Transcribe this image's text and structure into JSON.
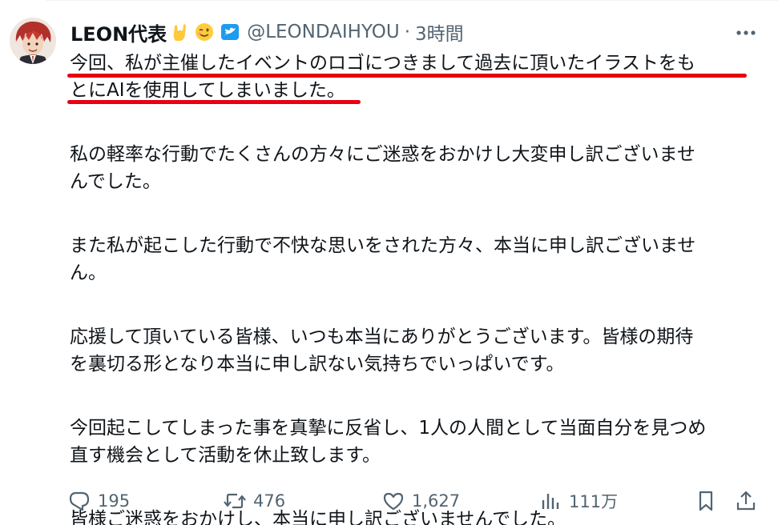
{
  "tweet": {
    "author": {
      "name": "LEON代表",
      "handle": "@LEONDAIHYOU",
      "emoji_1": "sign-of-horns-emoji",
      "emoji_2": "winking-face-emoji",
      "badge": "verified-badge-icon"
    },
    "separator": "·",
    "timestamp": "3時間",
    "body_lines": [
      "今回、私が主催したイベントのロゴにつきまして過去に頂いたイラストをも",
      "とにAIを使用してしまいました。",
      "",
      "私の軽率な行動でたくさんの方々にご迷惑をおかけし大変申し訳ございませ",
      "んでした。",
      "",
      "また私が起こした行動で不快な思いをされた方々、本当に申し訳ございませ",
      "ん。",
      "",
      "応援して頂いている皆様、いつも本当にありがとうございます。皆様の期待",
      "を裏切る形となり本当に申し訳ない気持ちでいっぱいです。",
      "",
      "今回起こしてしまった事を真摯に反省し、1人の人間として当面自分を見つめ",
      "直す機会として活動を休止致します。",
      "",
      "皆様ご迷惑をおかけし、本当に申し訳ございませんでした。"
    ],
    "highlight_color": "#e60012",
    "actions": {
      "replies": "195",
      "retweets": "476",
      "likes": "1,627",
      "views": "111万"
    },
    "icons": {
      "reply": "reply-icon",
      "retweet": "retweet-icon",
      "like": "heart-icon",
      "views": "views-chart-icon",
      "bookmark": "bookmark-icon",
      "share": "share-icon",
      "more": "more-icon"
    },
    "colors": {
      "text": "#0f1419",
      "secondary": "#536471",
      "verified": "#1d9bf0"
    }
  }
}
